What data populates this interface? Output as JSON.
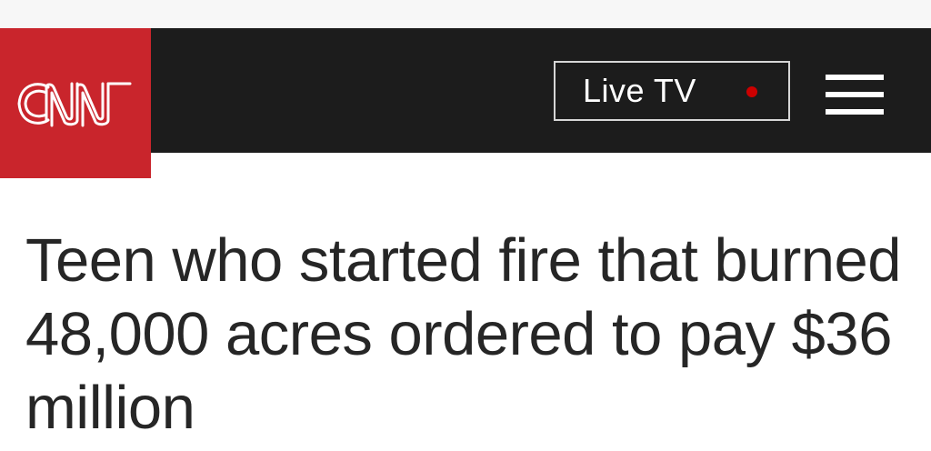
{
  "brand": {
    "logo_text": "CNN",
    "logo_color": "#c9252c",
    "navbar_color": "#1c1c1c"
  },
  "nav": {
    "live_tv_label": "Live TV",
    "live_indicator_color": "#cc0000",
    "menu_icon": "hamburger-menu-icon"
  },
  "article": {
    "headline": "Teen who started fire that burned 48,000 acres ordered to pay $36 million"
  }
}
